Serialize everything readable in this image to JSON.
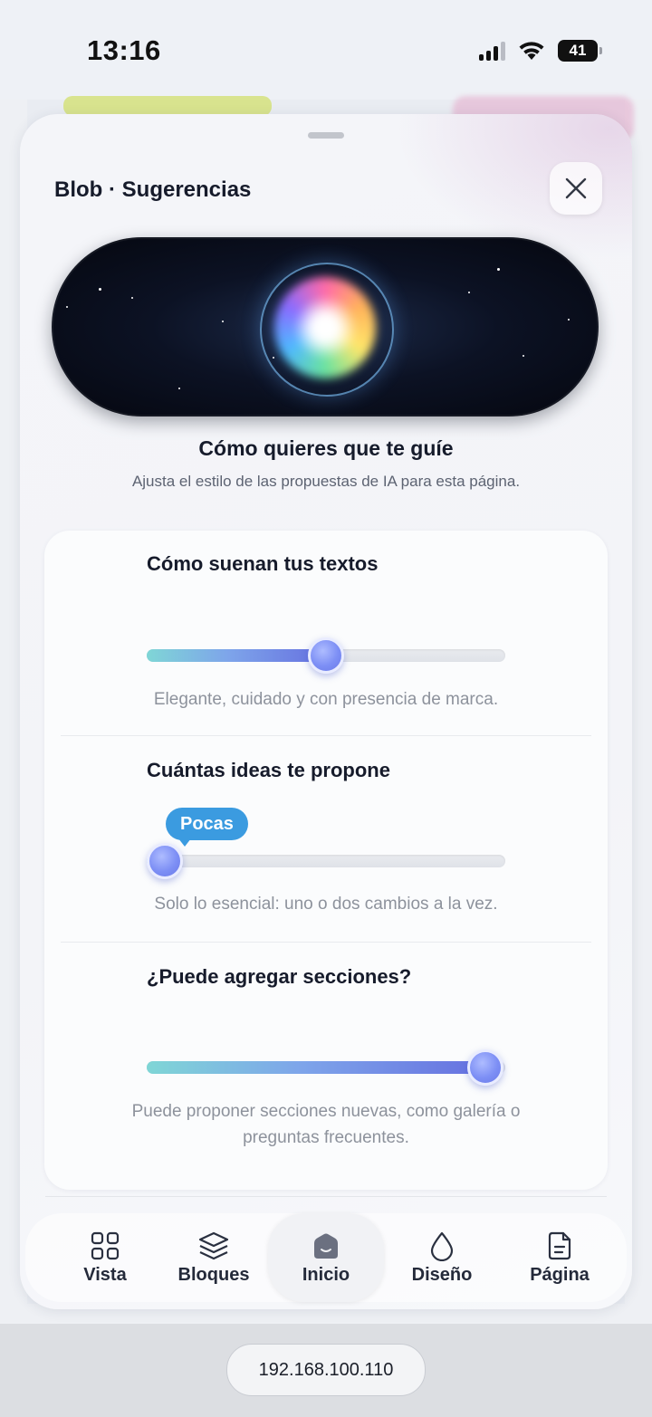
{
  "status_bar": {
    "time": "13:16",
    "battery": "41"
  },
  "sheet": {
    "title": "Blob · Sugerencias",
    "heading": "Cómo quieres que te guíe",
    "description": "Ajusta el estilo de las propuestas de IA para esta página."
  },
  "settings": [
    {
      "label": "Cómo suenan tus textos",
      "value_fraction": 0.5,
      "hint": "Elegante, cuidado y con presencia de marca."
    },
    {
      "label": "Cuántas ideas te propone",
      "value_fraction": 0.0,
      "bubble": "Pocas",
      "hint": "Solo lo esencial: uno o dos cambios a la vez."
    },
    {
      "label": "¿Puede agregar secciones?",
      "value_fraction": 1.0,
      "hint_line1": "Puede proponer secciones nuevas, como galería o",
      "hint_line2": "preguntas frecuentes."
    }
  ],
  "nav": {
    "items": [
      {
        "label": "Vista",
        "icon": "grid-icon"
      },
      {
        "label": "Bloques",
        "icon": "layers-icon"
      },
      {
        "label": "Inicio",
        "icon": "home-icon",
        "active": true
      },
      {
        "label": "Diseño",
        "icon": "droplet-icon"
      },
      {
        "label": "Página",
        "icon": "document-icon"
      }
    ]
  },
  "browser": {
    "url": "192.168.100.110"
  }
}
